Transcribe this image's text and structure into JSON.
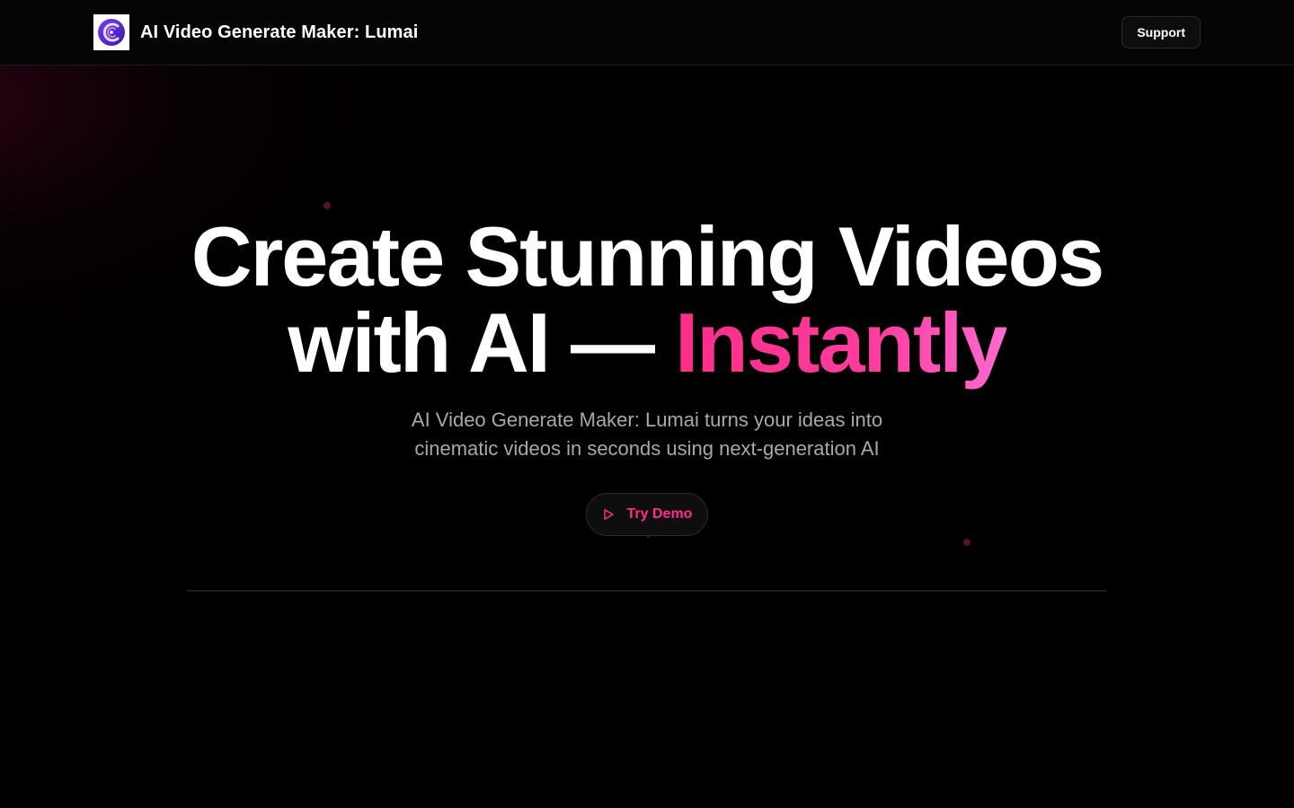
{
  "header": {
    "brand_title": "AI Video Generate Maker: Lumai",
    "support_label": "Support"
  },
  "hero": {
    "headline_line1": "Create Stunning Videos",
    "headline_line2_prefix": "with AI — ",
    "headline_accent": "Instantly",
    "subtitle": "AI Video Generate Maker: Lumai turns your ideas into cinematic videos in seconds using next-generation AI",
    "cta_label": "Try Demo"
  },
  "colors": {
    "background": "#000000",
    "accent": "#ff2d8a",
    "subtitle_text": "#a8a8a8",
    "logo_purple": "#5b2bd6"
  },
  "icons": {
    "logo": "lumai-logo-icon",
    "cta": "play-icon"
  }
}
